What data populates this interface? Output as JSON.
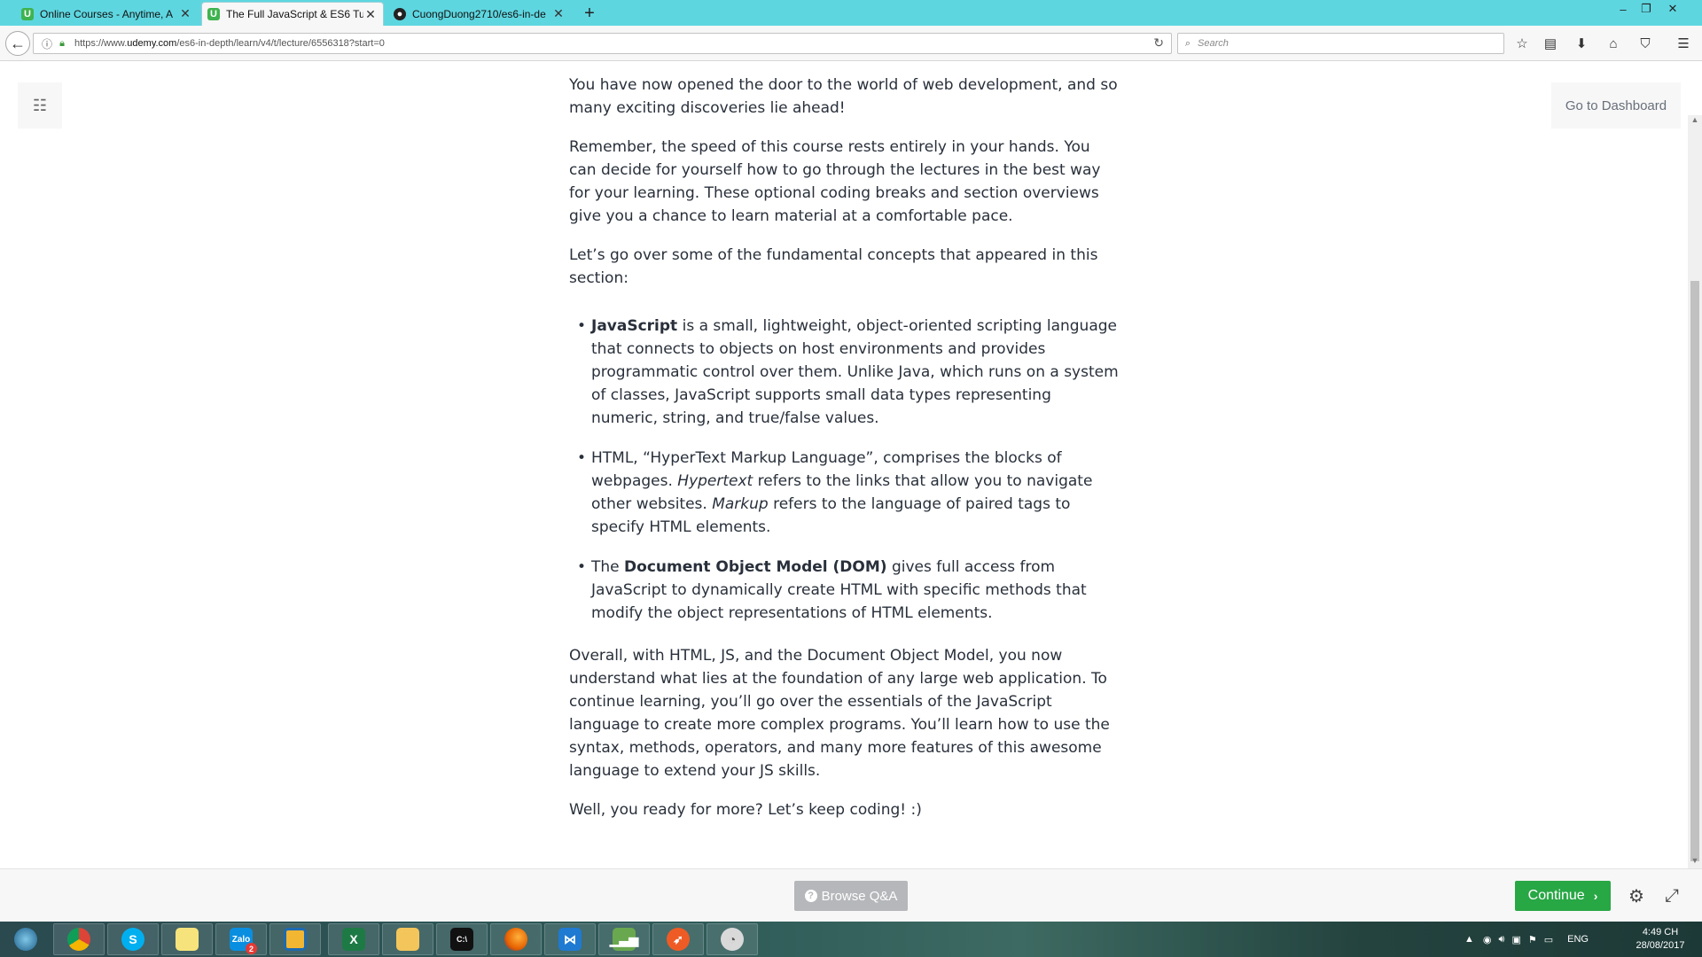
{
  "browser": {
    "tabs": [
      {
        "title": "Online Courses - Anytime, A",
        "icon": "udemy-icon",
        "active": false
      },
      {
        "title": "The Full JavaScript & ES6 Tu",
        "icon": "udemy-icon",
        "active": true
      },
      {
        "title": "CuongDuong2710/es6-in-de",
        "icon": "github-icon",
        "active": false
      }
    ],
    "new_tab": "+",
    "url_prefix": "https://www.",
    "url_domain": "udemy.com",
    "url_path": "/es6-in-depth/learn/v4/t/lecture/6556318?start=0",
    "search_placeholder": "Search"
  },
  "page": {
    "dashboard_label": "Go to Dashboard",
    "article": {
      "cut_off_line": "You have now opened the door to the world of web development, and so",
      "p1_end": "many exciting discoveries lie ahead!",
      "p2": "Remember, the speed of this course rests entirely in your hands. You can decide for yourself how to go through the lectures in the best way for your learning. These optional coding breaks and section overviews give you a chance to learn material at a comfortable pace.",
      "p3": "Let’s go over some of the fundamental concepts that appeared in this section:",
      "b1_strong": "JavaScript",
      "b1_rest": " is a small, lightweight, object-oriented scripting language that connects to objects on host environments and provides programmatic control over them. Unlike Java, which runs on a system of classes, JavaScript supports small data types representing numeric, string, and true/false values.",
      "b2_a": "HTML, “HyperText Markup Language”, comprises the blocks of webpages. ",
      "b2_em1": "Hypertext",
      "b2_b": " refers to the links that allow you to navigate other websites. ",
      "b2_em2": "Markup",
      "b2_c": " refers to the language of paired tags to specify HTML elements.",
      "b3_a": "The ",
      "b3_strong": "Document Object Model (DOM)",
      "b3_rest": " gives full access from JavaScript to dynamically create HTML with specific methods that modify the object representations of HTML elements.",
      "p4": "Overall, with HTML, JS, and the Document Object Model, you now understand what lies at the foundation of any large web application. To continue learning, you’ll go over the essentials of the JavaScript language to create more complex programs. You’ll learn how to use the syntax, methods, operators, and many more features of this awesome language to extend your JS skills.",
      "p5": "Well, you ready for more? Let’s keep coding! :)"
    }
  },
  "footer": {
    "browse_label": "Browse Q&A",
    "continue_label": "Continue"
  },
  "taskbar": {
    "apps": [
      "start-orb-icon",
      "chrome-icon",
      "skype-icon",
      "sticky-notes-icon",
      "zalo-icon",
      "file-manager-icon",
      "excel-icon",
      "folder-icon",
      "cmd-icon",
      "firefox-icon",
      "vscode-icon",
      "chart-app-icon",
      "postman-icon",
      "paint-icon"
    ],
    "zalo_badge": "2",
    "language": "ENG",
    "time": "4:49 CH",
    "date": "28/08/2017"
  },
  "colors": {
    "tabbar": "#5ed6e0",
    "continue": "#28a745",
    "browse": "#b5b7ba",
    "text": "#29303b"
  }
}
